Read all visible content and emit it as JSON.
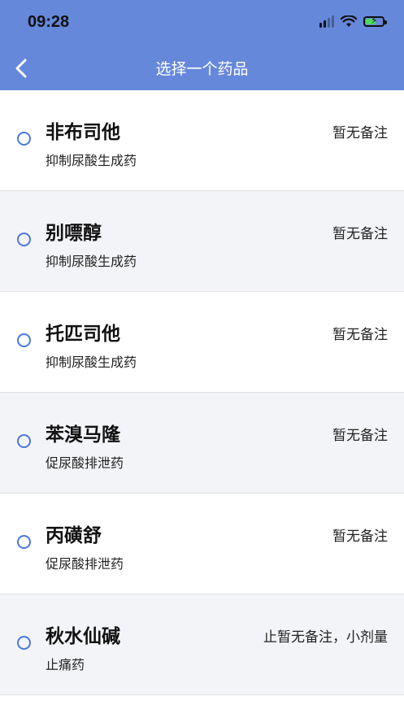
{
  "status_bar": {
    "time": "09:28",
    "battery_level": 0.6,
    "battery_color": "#4cd964"
  },
  "header": {
    "title": "选择一个药品",
    "background": "#6688db",
    "back_icon": "chevron-left-icon"
  },
  "medicines": [
    {
      "name": "非布司他",
      "category": "抑制尿酸生成药",
      "note": "暂无备注"
    },
    {
      "name": "别嘌醇",
      "category": "抑制尿酸生成药",
      "note": "暂无备注"
    },
    {
      "name": "托匹司他",
      "category": "抑制尿酸生成药",
      "note": "暂无备注"
    },
    {
      "name": "苯溴马隆",
      "category": "促尿酸排泄药",
      "note": "暂无备注"
    },
    {
      "name": "丙磺舒",
      "category": "促尿酸排泄药",
      "note": "暂无备注"
    },
    {
      "name": "秋水仙碱",
      "category": "止痛药",
      "note": "止暂无备注，小剂量"
    }
  ],
  "radio_color": "#4a78d8"
}
